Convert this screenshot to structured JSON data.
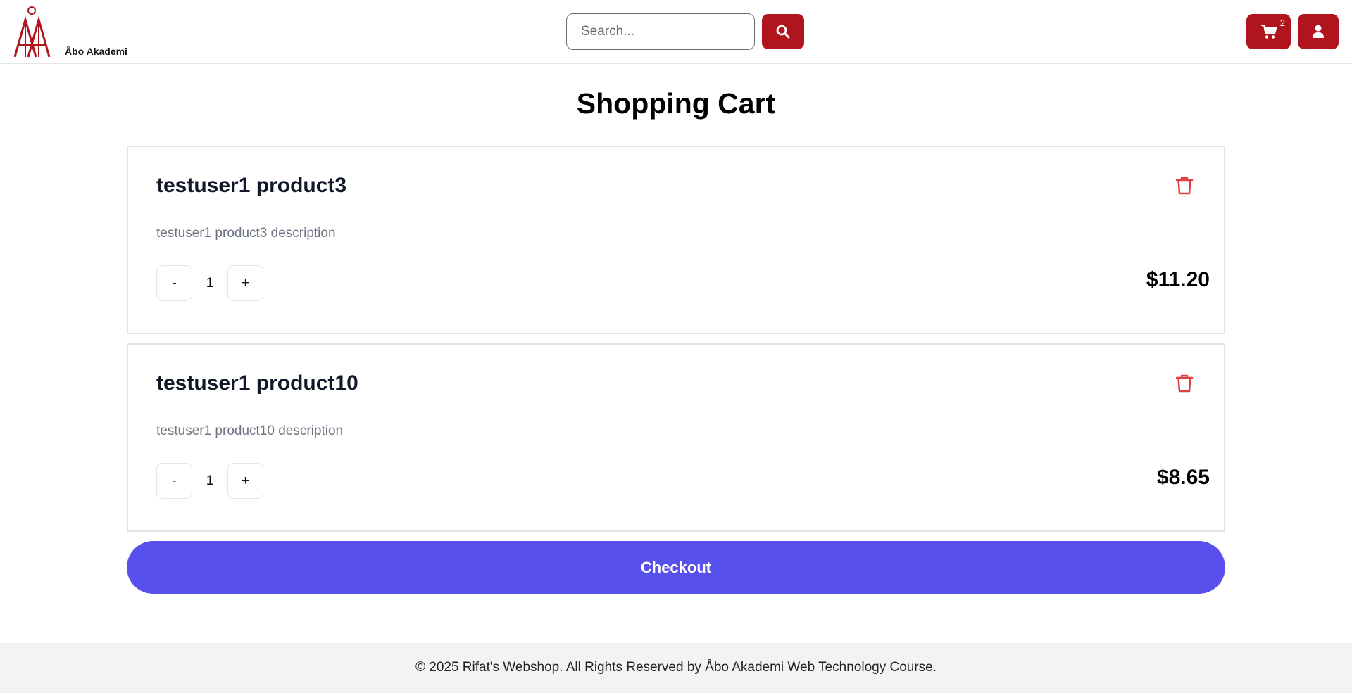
{
  "header": {
    "logo_text": "Åbo Akademi",
    "search": {
      "placeholder": "Search...",
      "value": ""
    },
    "cart_count": "2",
    "icons": {
      "search": "search-icon",
      "cart": "cart-icon",
      "user": "user-icon"
    },
    "accent_color": "#b0141c"
  },
  "main": {
    "title": "Shopping Cart",
    "items": [
      {
        "name": "testuser1 product3",
        "description": "testuser1 product3 description",
        "minus_label": "-",
        "quantity": "1",
        "plus_label": "+",
        "price": "$11.20"
      },
      {
        "name": "testuser1 product10",
        "description": "testuser1 product10 description",
        "minus_label": "-",
        "quantity": "1",
        "plus_label": "+",
        "price": "$8.65"
      }
    ],
    "checkout_label": "Checkout",
    "checkout_color": "#5850ec",
    "delete_icon": "trash-icon",
    "delete_color": "#e53e3e"
  },
  "footer": {
    "text": "© 2025 Rifat's Webshop. All Rights Reserved by Åbo Akademi Web Technology Course."
  }
}
